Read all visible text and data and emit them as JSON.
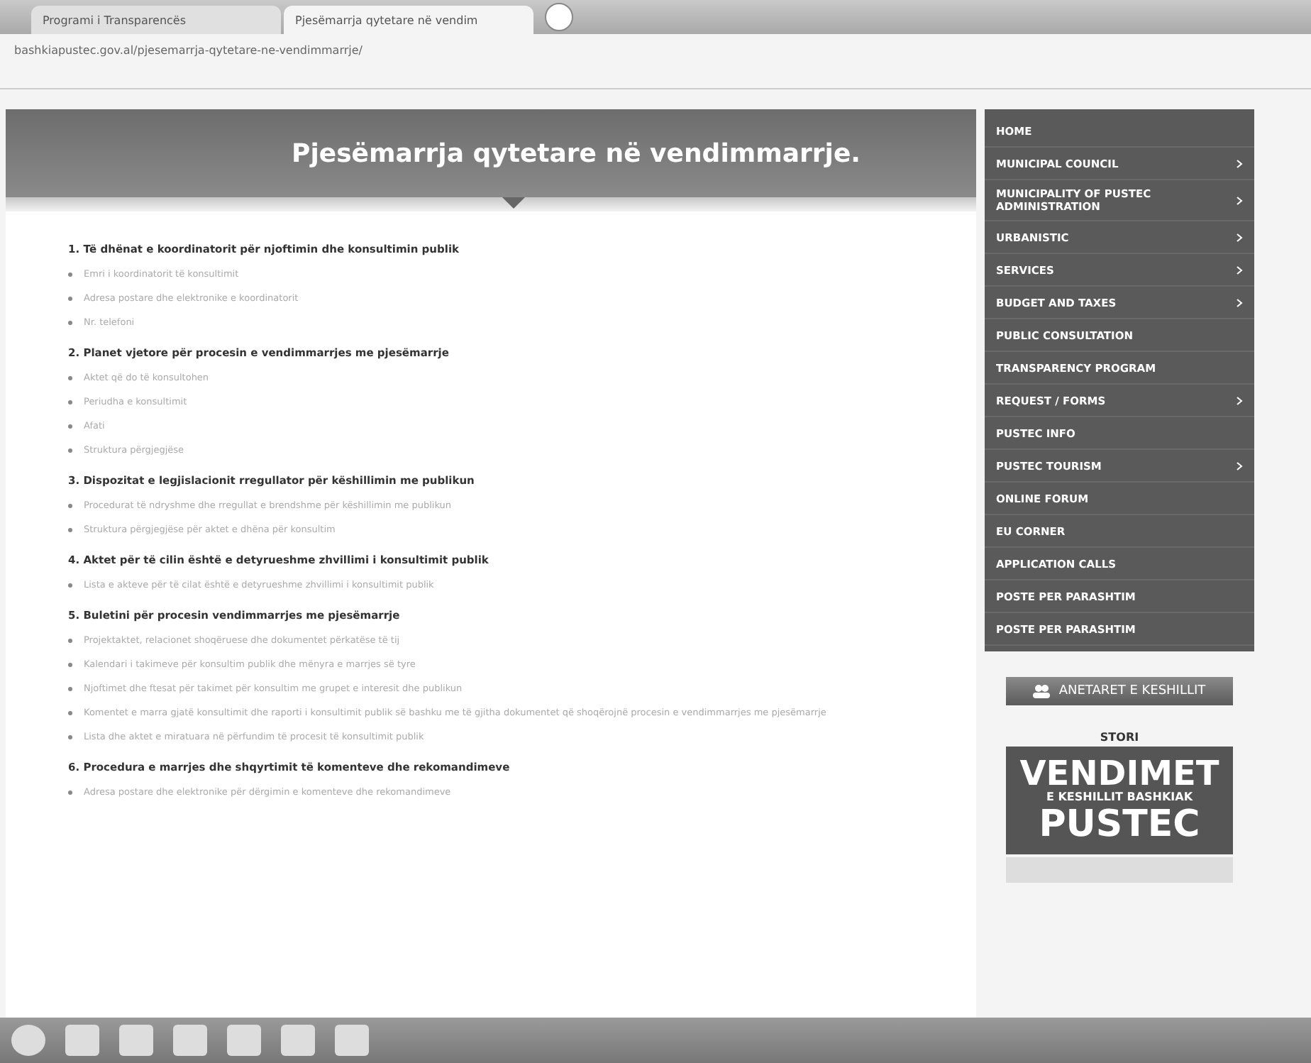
{
  "browser": {
    "tabs": [
      {
        "title": "Programi i Transparencës",
        "selected": false
      },
      {
        "title": "Pjesëmarrja qytetare në vendim",
        "selected": true
      }
    ],
    "address": "bashkiapustec.gov.al/pjesemarrja-qytetare-ne-vendimmarrje/"
  },
  "page": {
    "title": "Pjesëmarrja qytetare në vendimmarrje.",
    "sections": [
      {
        "number": "1.",
        "heading": "Të dhënat e koordinatorit për njoftimin dhe konsultimin publik",
        "items": [
          "Emri i koordinatorit të konsultimit",
          "Adresa postare dhe elektronike e koordinatorit",
          "Nr. telefoni"
        ]
      },
      {
        "number": "2.",
        "heading": "Planet vjetore për procesin e vendimmarrjes me pjesëmarrje",
        "items": [
          "Aktet që do të konsultohen",
          "Periudha e konsultimit",
          "Afati",
          "Struktura përgjegjëse"
        ]
      },
      {
        "number": "3.",
        "heading": "Dispozitat e legjislacionit rregullator për këshillimin me publikun",
        "items": [
          "Procedurat të ndryshme dhe rregullat e brendshme për këshillimin me publikun",
          "Struktura përgjegjëse për aktet e dhëna për konsultim"
        ]
      },
      {
        "number": "4.",
        "heading": "Aktet për të cilin është e detyrueshme zhvillimi i konsultimit publik",
        "items": [
          "Lista e akteve për të cilat është e detyrueshme zhvillimi i konsultimit publik"
        ]
      },
      {
        "number": "5.",
        "heading": "Buletini për procesin vendimmarrjes me pjesëmarrje",
        "items": [
          "Projektaktet, relacionet shoqëruese dhe dokumentet përkatëse të tij",
          "Kalendari i takimeve për konsultim publik dhe mënyra e marrjes së tyre",
          "Njoftimet dhe ftesat për takimet për konsultim me grupet e interesit dhe publikun",
          "Komentet e marra gjatë konsultimit dhe raporti i konsultimit publik së bashku me të gjitha dokumentet që shoqërojnë procesin e vendimmarrjes me pjesëmarrje",
          "Lista dhe aktet e miratuara në përfundim të procesit të konsultimit publik"
        ]
      },
      {
        "number": "6.",
        "heading": "Procedura e marrjes dhe shqyrtimit të komenteve dhe rekomandimeve",
        "items": [
          "Adresa postare dhe elektronike për dërgimin e komenteve dhe rekomandimeve"
        ]
      }
    ]
  },
  "menu": [
    {
      "label": "HOME",
      "submenu": false
    },
    {
      "label": "MUNICIPAL COUNCIL",
      "submenu": true
    },
    {
      "label": "MUNICIPALITY OF PUSTEC ADMINISTRATION",
      "submenu": true
    },
    {
      "label": "URBANISTIC",
      "submenu": true
    },
    {
      "label": "SERVICES",
      "submenu": true
    },
    {
      "label": "BUDGET AND TAXES",
      "submenu": true
    },
    {
      "label": "PUBLIC CONSULTATION",
      "submenu": false
    },
    {
      "label": "TRANSPARENCY PROGRAM",
      "submenu": false
    },
    {
      "label": "REQUEST / FORMS",
      "submenu": true
    },
    {
      "label": "PUSTEC INFO",
      "submenu": false
    },
    {
      "label": "PUSTEC TOURISM",
      "submenu": true
    },
    {
      "label": "ONLINE FORUM",
      "submenu": false
    },
    {
      "label": "EU CORNER",
      "submenu": false
    },
    {
      "label": "APPLICATION CALLS",
      "submenu": false
    },
    {
      "label": "POSTE PER PARASHTIM",
      "submenu": false
    },
    {
      "label": "POSTE PER PARASHTIM",
      "submenu": false
    }
  ],
  "council_button": "ANETARET E KESHILLIT",
  "poster": {
    "caption": "STORI",
    "line_1": "VENDIMET",
    "line_2": "E KESHILLIT BASHKIAK",
    "line_3": "PUSTEC"
  }
}
